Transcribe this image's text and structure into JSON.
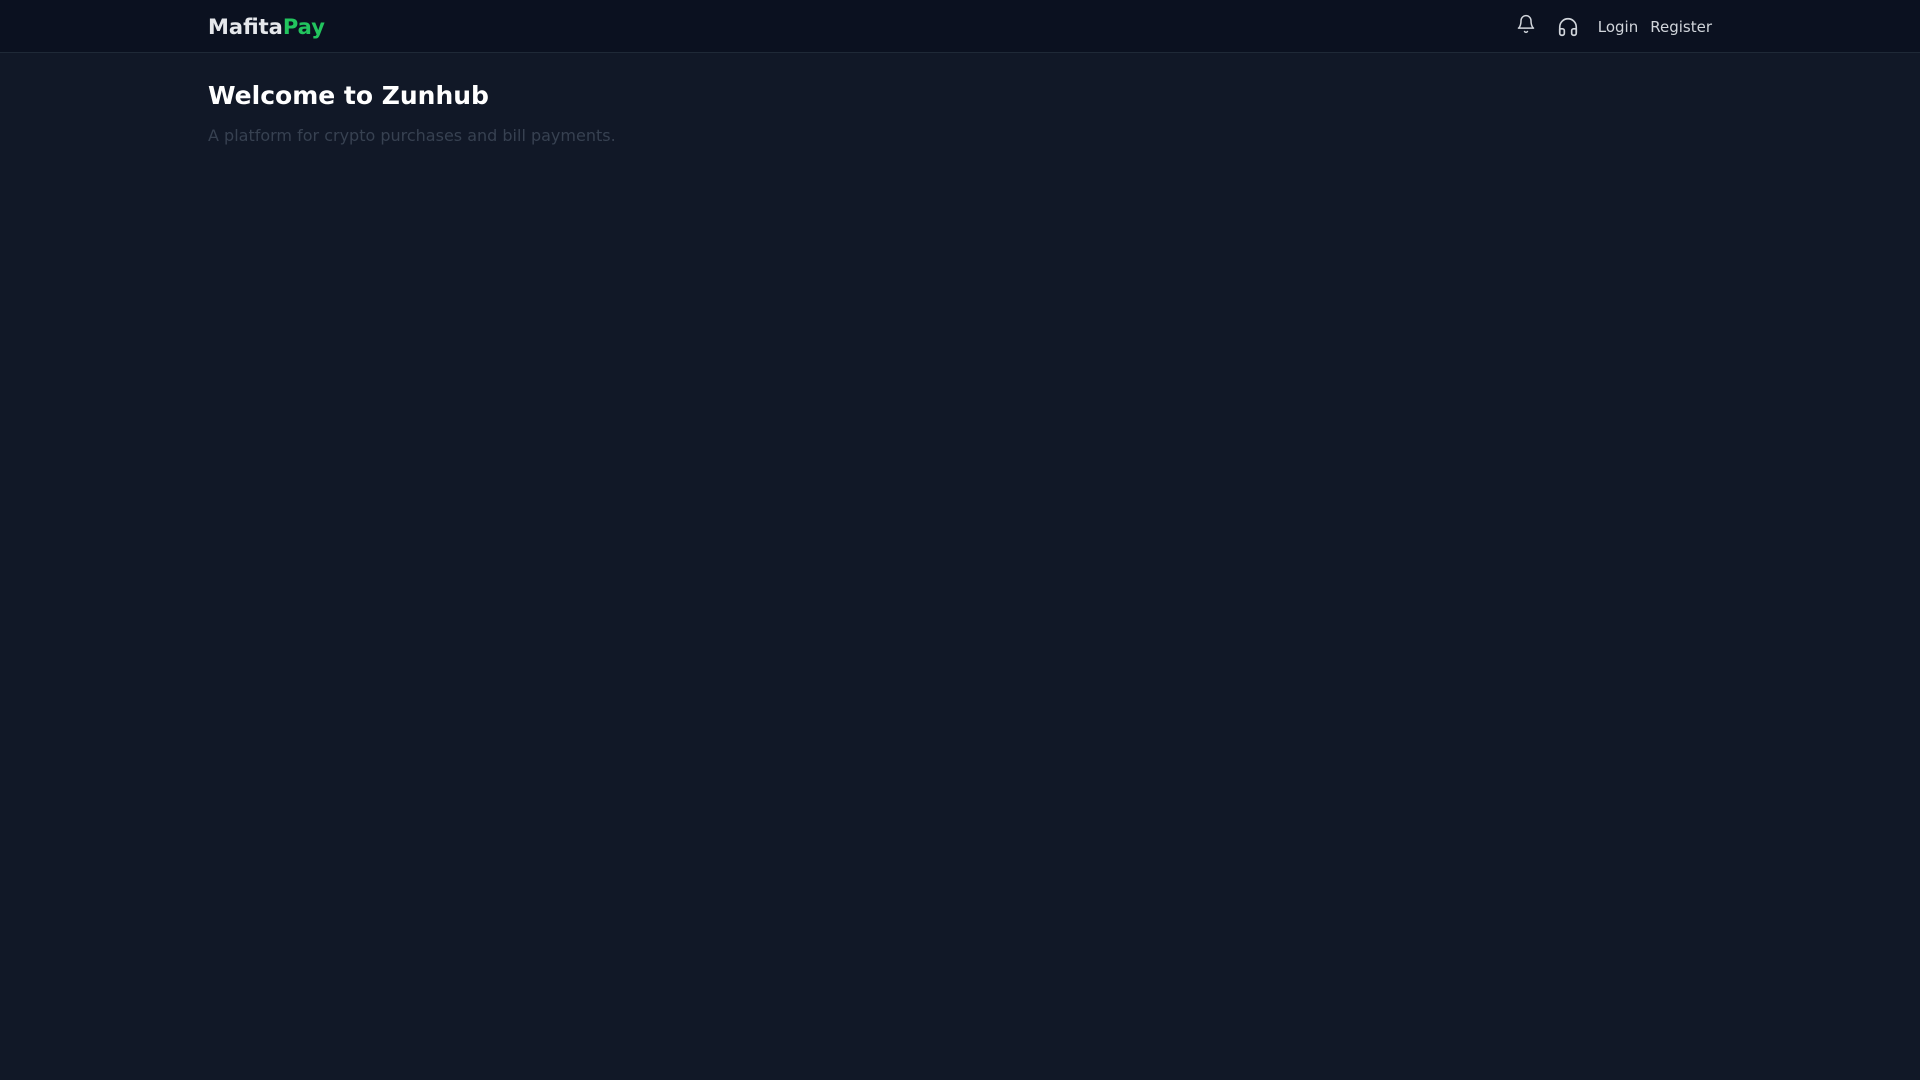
{
  "navbar": {
    "brand": {
      "part1": "Mafita",
      "part2": "Pay",
      "accent_color": "#22c55e"
    },
    "icons": {
      "notifications": "bell-icon",
      "support": "headphones-icon"
    },
    "login_label": "Login",
    "register_label": "Register"
  },
  "main": {
    "title": "Welcome to Zunhub",
    "subtitle": "A platform for crypto purchases and bill payments."
  },
  "colors": {
    "background": "#111827",
    "navbar_background": "#0b1120",
    "title_text": "#ffffff",
    "subtitle_text": "#374151",
    "nav_text": "#d1d5db"
  }
}
